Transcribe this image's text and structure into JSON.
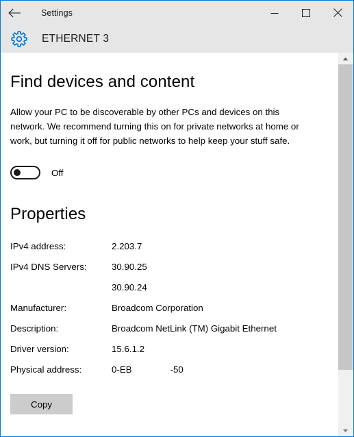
{
  "window": {
    "border_color": "#0078d7",
    "titlebar_bg": "#e6e6e6",
    "title": "Settings",
    "back_icon": "back-arrow-icon",
    "minimize_icon": "minimize-icon",
    "maximize_icon": "maximize-icon",
    "close_icon": "close-icon"
  },
  "header": {
    "gear_icon": "gear-icon",
    "gear_color": "#0078d7",
    "adapter_name": "ETHERNET 3"
  },
  "find_devices": {
    "heading": "Find devices and content",
    "description": "Allow your PC to be discoverable by other PCs and devices on this network. We recommend turning this on for private networks at home or work, but turning it off for public networks to help keep your stuff safe.",
    "toggle_state_label": "Off",
    "toggle_on": false
  },
  "properties": {
    "heading": "Properties",
    "rows": [
      {
        "key": "IPv4 address:",
        "value": "2.203.7",
        "redacted": true
      },
      {
        "key": "IPv4 DNS Servers:",
        "value": "30.90.25",
        "redacted": false
      },
      {
        "key": "",
        "value": "30.90.24",
        "redacted": false
      },
      {
        "key": "Manufacturer:",
        "value": "Broadcom Corporation",
        "redacted": false
      },
      {
        "key": "Description:",
        "value": "Broadcom NetLink (TM) Gigabit Ethernet",
        "redacted": false
      },
      {
        "key": "Driver version:",
        "value": "15.6.1.2",
        "redacted": false
      }
    ],
    "physical_address": {
      "key": "Physical address:",
      "value_start": "0-EB",
      "value_end": "-50"
    },
    "copy_label": "Copy"
  },
  "scrollbar": {
    "up_icon": "scroll-up-arrow-icon",
    "down_icon": "scroll-down-arrow-icon",
    "thumb_color": "#c6c6c6",
    "track_color": "#f0f0f0"
  }
}
